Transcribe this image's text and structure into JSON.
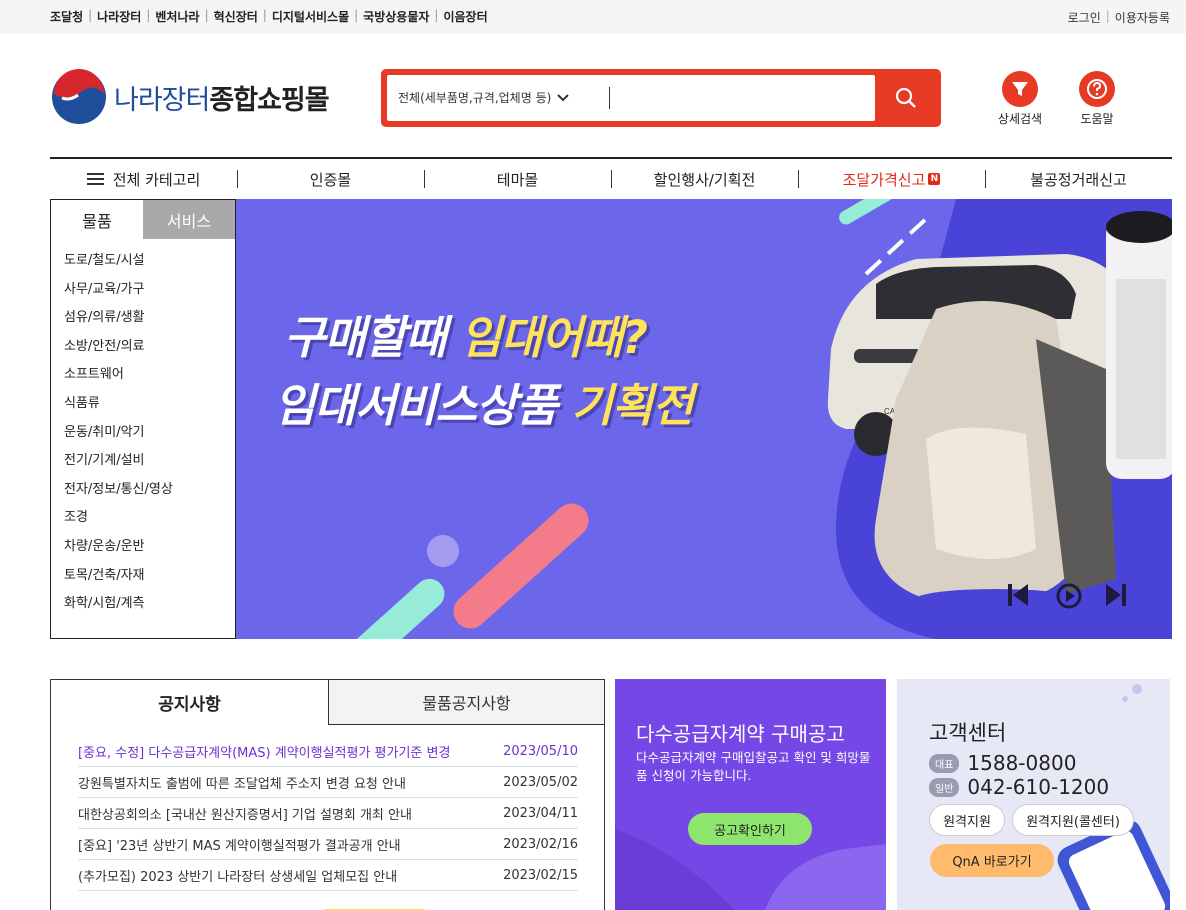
{
  "top_links": [
    "조달청",
    "나라장터",
    "벤처나라",
    "혁신장터",
    "디지털서비스몰",
    "국방상용물자",
    "이음장터"
  ],
  "account": {
    "login": "로그인",
    "signup": "이용자등록"
  },
  "logo": {
    "part1": "나라장터",
    "part2": "종합쇼핑몰"
  },
  "search": {
    "scope": "전체(세부품명,규격,업체명 등)",
    "value": ""
  },
  "utils": {
    "detail_search": "상세검색",
    "help": "도움말"
  },
  "nav": {
    "all_categories": "전체 카테고리",
    "cert_mall": "인증몰",
    "theme_mall": "테마몰",
    "sale": "할인행사/기획전",
    "price_report": "조달가격신고",
    "price_badge": "N",
    "unfair": "불공정거래신고"
  },
  "category": {
    "tabs": [
      "물품",
      "서비스"
    ],
    "items": [
      "도로/철도/시설",
      "사무/교육/가구",
      "섬유/의류/생활",
      "소방/안전/의료",
      "소프트웨어",
      "식품류",
      "운동/취미/악기",
      "전기/기계/설비",
      "전자/정보/통신/영상",
      "조경",
      "차량/운송/운반",
      "토목/건축/자재",
      "화학/시험/계측"
    ]
  },
  "banner": {
    "line1a": "구매할때 ",
    "line1b": "임대어때?",
    "line2a": "임대서비스상품 ",
    "line2b": "기획전",
    "car_label": "CASPER"
  },
  "notice": {
    "tab_notice": "공지사항",
    "tab_goods": "물품공지사항",
    "rows": [
      {
        "title": "[중요, 수정] 다수공급자계약(MAS) 계약이행실적평가 평가기준 변경",
        "date": "2023/05/10"
      },
      {
        "title": "강원특별자치도 출범에 따른 조달업체 주소지 변경 요청 안내",
        "date": "2023/05/02"
      },
      {
        "title": "대한상공회의소 [국내산 원산지증명서] 기업 설명회 개최 안내",
        "date": "2023/04/11"
      },
      {
        "title": "[중요] '23년 상반기 MAS 계약이행실적평가 결과공개 안내",
        "date": "2023/02/16"
      },
      {
        "title": "(추가모집) 2023 상반기 나라장터 상생세일 업체모집 안내",
        "date": "2023/02/15"
      }
    ]
  },
  "promo": {
    "title": "다수공급자계약 구매공고",
    "desc": "다수공급자계약 구매입찰공고 확인 및 희망물품 신청이 가능합니다.",
    "button": "공고확인하기"
  },
  "cs": {
    "title": "고객센터",
    "rep_label": "대표",
    "rep_num": "1588-0800",
    "gen_label": "일반",
    "gen_num": "042-610-1200",
    "remote": "원격지원",
    "remote_call": "원격지원(콜센터)",
    "qna": "QnA 바로가기"
  },
  "colors": {
    "accent": "#e63a24",
    "banner_bg": "#6b66ea",
    "promo_bg": "#7447e6",
    "highlight": "#6a33cf"
  }
}
